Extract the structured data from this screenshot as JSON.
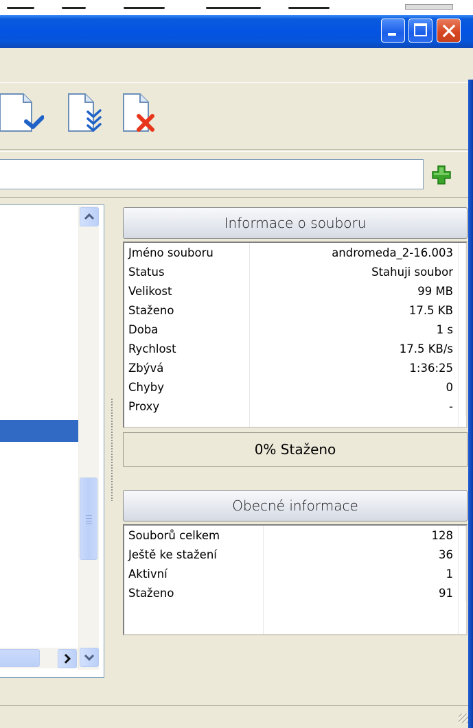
{
  "window": {
    "minimize_icon": "minimize-icon",
    "maximize_icon": "maximize-icon",
    "close_icon": "close-icon"
  },
  "toolbar": {
    "icons": [
      "download-file-icon",
      "download-all-icon",
      "remove-file-icon"
    ]
  },
  "url_bar": {
    "value": "",
    "add_icon": "add-plus-icon"
  },
  "file_info": {
    "header": "Informace o souboru",
    "rows": [
      {
        "label": "Jméno souboru",
        "value": "andromeda_2-16.003"
      },
      {
        "label": "Status",
        "value": "Stahuji soubor"
      },
      {
        "label": "Velikost",
        "value": "99 MB"
      },
      {
        "label": "Staženo",
        "value": "17.5 KB"
      },
      {
        "label": "Doba",
        "value": "1 s"
      },
      {
        "label": "Rychlost",
        "value": "17.5 KB/s"
      },
      {
        "label": "Zbývá",
        "value": "1:36:25"
      },
      {
        "label": "Chyby",
        "value": "0"
      },
      {
        "label": "Proxy",
        "value": "-"
      }
    ]
  },
  "progress": {
    "text": "0% Staženo",
    "percent": 0
  },
  "general_info": {
    "header": "Obecné informace",
    "rows": [
      {
        "label": "Souborů celkem",
        "value": "128"
      },
      {
        "label": "Ještě ke stažení",
        "value": "36"
      },
      {
        "label": "Aktivní",
        "value": "1"
      },
      {
        "label": "Staženo",
        "value": "91"
      }
    ]
  },
  "colors": {
    "titlebar": "#0553E3",
    "selection": "#316AC5",
    "add_green": "#3AA52A",
    "remove_red": "#E8361C",
    "download_blue": "#1F62C8"
  }
}
